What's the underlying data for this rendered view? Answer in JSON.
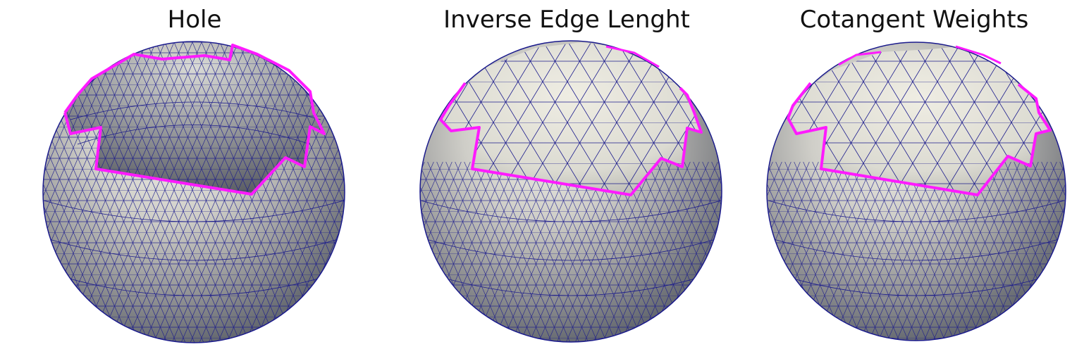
{
  "panels": [
    {
      "title": "Hole"
    },
    {
      "title": "Inverse Edge Lenght"
    },
    {
      "title": "Cotangent Weights"
    }
  ],
  "colors": {
    "mesh_edge": "#1a1a8c",
    "hole_boundary": "#ff1aff",
    "sphere_light": "#ecebe2",
    "sphere_mid": "#a9a9a6",
    "sphere_dark": "#4f5560",
    "interior_dark": "#5d5f66",
    "interior_light": "#d5d6d2"
  }
}
